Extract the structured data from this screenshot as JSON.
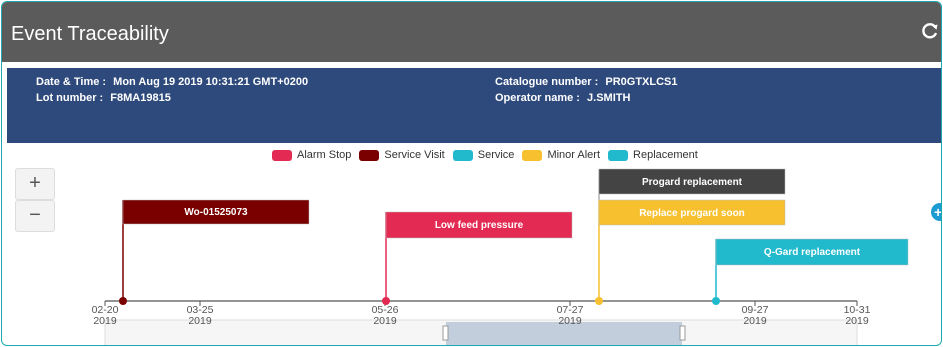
{
  "window": {
    "title": "Event Traceability",
    "refresh_icon": "refresh-icon"
  },
  "info": {
    "datetime_label": "Date & Time :",
    "datetime_value": "Mon Aug 19 2019 10:31:21 GMT+0200",
    "lot_label": "Lot number :",
    "lot_value": "F8MA19815",
    "catalogue_label": "Catalogue number :",
    "catalogue_value": "PR0GTXLCS1",
    "operator_label": "Operator name :",
    "operator_value": "J.SMITH"
  },
  "legend": [
    {
      "label": "Alarm Stop",
      "color": "#e32a52"
    },
    {
      "label": "Service Visit",
      "color": "#7a0000"
    },
    {
      "label": "Service",
      "color": "#21b9cc"
    },
    {
      "label": "Minor Alert",
      "color": "#f6c02f"
    },
    {
      "label": "Replacement",
      "color": "#21b9cc"
    }
  ],
  "zoom": {
    "in_label": "+",
    "out_label": "−"
  },
  "side_button_label": "+",
  "timeline": {
    "ticks": [
      {
        "date": "02-20",
        "year": "2019"
      },
      {
        "date": "03-25",
        "year": "2019"
      },
      {
        "date": "05-26",
        "year": "2019"
      },
      {
        "date": "07-27",
        "year": "2019"
      },
      {
        "date": "09-27",
        "year": "2019"
      },
      {
        "date": "10-31",
        "year": "2019"
      }
    ],
    "events": [
      {
        "label": "Wo-01525073",
        "type": "Service Visit",
        "color": "#7a0000"
      },
      {
        "label": "Low feed pressure",
        "type": "Alarm Stop",
        "color": "#e32a52"
      },
      {
        "label": "Progard replacement",
        "type": "Replacement",
        "color": "#444444"
      },
      {
        "label": "Replace progard soon",
        "type": "Minor Alert",
        "color": "#f6c02f"
      },
      {
        "label": "Q-Gard replacement",
        "type": "Replacement",
        "color": "#21b9cc"
      }
    ]
  }
}
